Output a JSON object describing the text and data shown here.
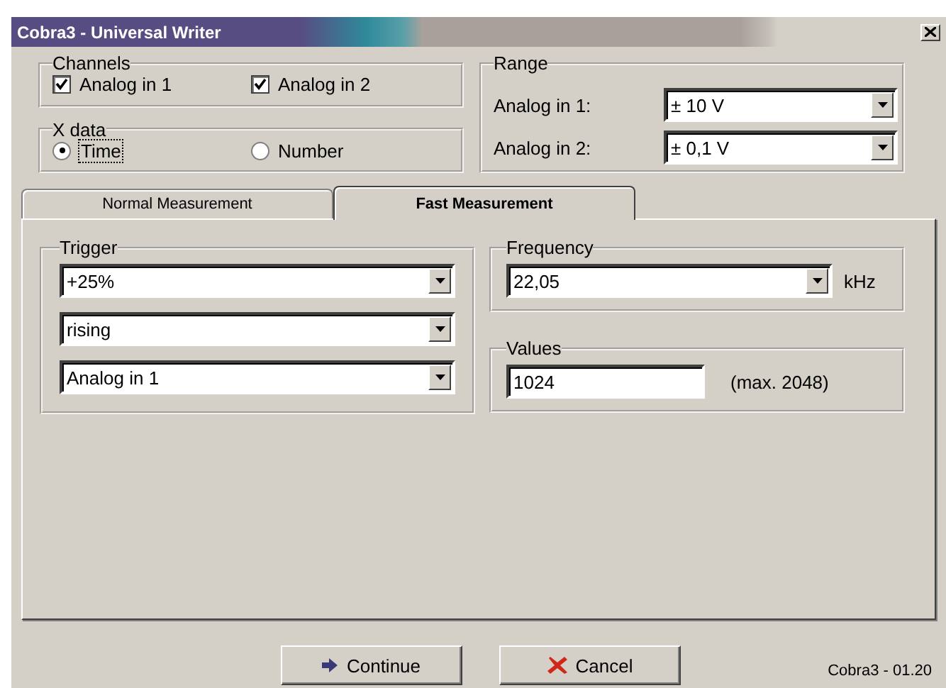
{
  "window": {
    "title": "Cobra3 - Universal Writer"
  },
  "channels": {
    "label": "Channels",
    "items": [
      {
        "label": "Analog in 1",
        "checked": true
      },
      {
        "label": "Analog in 2",
        "checked": true
      }
    ]
  },
  "x_data": {
    "label": "X data",
    "options": [
      {
        "label": "Time",
        "selected": true,
        "focused": true
      },
      {
        "label": "Number",
        "selected": false,
        "focused": false
      }
    ]
  },
  "range": {
    "label": "Range",
    "rows": [
      {
        "label": "Analog in 1:",
        "value": "± 10 V"
      },
      {
        "label": "Analog in 2:",
        "value": "± 0,1 V"
      }
    ]
  },
  "tabs": [
    {
      "label": "Normal Measurement",
      "selected": false
    },
    {
      "label": "Fast Measurement",
      "selected": true
    }
  ],
  "trigger": {
    "label": "Trigger",
    "selects": [
      "+25%",
      "rising",
      "Analog in 1"
    ]
  },
  "frequency": {
    "label": "Frequency",
    "value": "22,05",
    "unit": "kHz"
  },
  "values": {
    "label": "Values",
    "value": "1024",
    "hint": "(max. 2048)"
  },
  "buttons": [
    {
      "label": "Continue",
      "kind": "continue"
    },
    {
      "label": "Cancel",
      "kind": "cancel"
    }
  ],
  "version": "Cobra3 - 01.20"
}
